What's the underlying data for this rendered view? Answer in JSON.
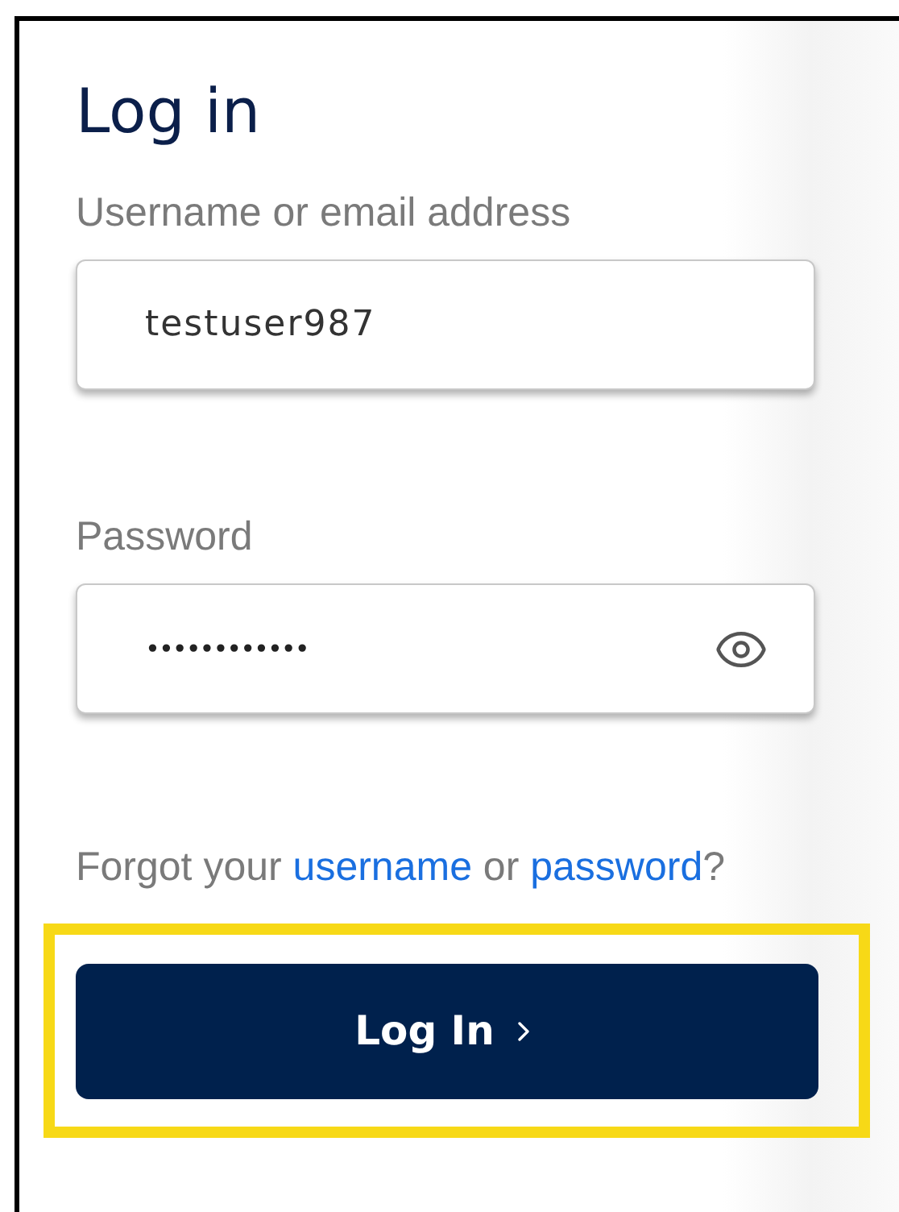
{
  "title": "Log in",
  "fields": [
    {
      "kind": "text",
      "label": "Username or email address",
      "value": "testuser987"
    },
    {
      "kind": "password",
      "label": "Password",
      "value": "••••••••••••"
    }
  ],
  "forgot": {
    "prefix": "Forgot your",
    "username_link": "username",
    "middle": "or",
    "password_link": "password",
    "suffix": "?"
  },
  "login_button": {
    "label": "Log In",
    "highlighted": true
  }
}
